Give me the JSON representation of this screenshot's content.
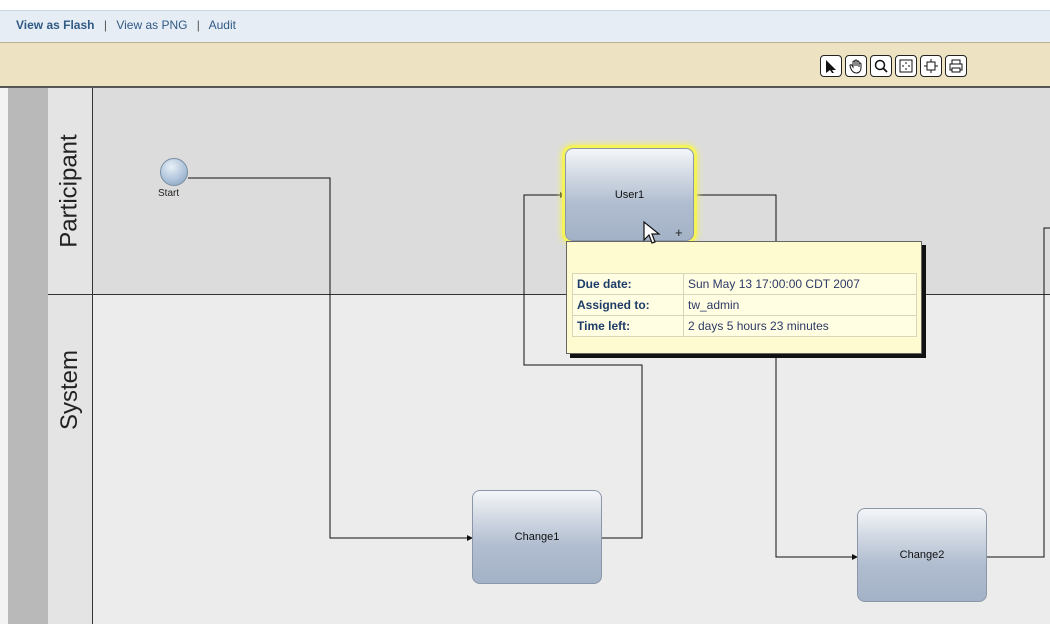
{
  "links": {
    "view_flash": "View as Flash",
    "separator": "|",
    "view_png": "View as PNG",
    "audit": "Audit"
  },
  "toolbar": {
    "buttons": [
      {
        "name": "select-tool",
        "icon": "arrow-pointer-icon"
      },
      {
        "name": "pan-tool",
        "icon": "hand-icon"
      },
      {
        "name": "zoom-tool",
        "icon": "magnifier-icon"
      },
      {
        "name": "fit-to-window",
        "icon": "fit-icon"
      },
      {
        "name": "center-view",
        "icon": "center-icon"
      },
      {
        "name": "print",
        "icon": "printer-icon"
      }
    ]
  },
  "lanes": {
    "participant": "Participant",
    "system": "System"
  },
  "nodes": {
    "start": "Start",
    "user1": "User1",
    "change1": "Change1",
    "change2": "Change2"
  },
  "tooltip": {
    "rows": [
      {
        "label": "Due date:",
        "value": "Sun May 13 17:00:00 CDT 2007"
      },
      {
        "label": "Assigned to:",
        "value": "tw_admin"
      },
      {
        "label": "Time left:",
        "value": "2 days 5 hours 23 minutes"
      }
    ]
  },
  "cursor_plus": "+",
  "colors": {
    "link": "#315a85",
    "toolbar_bg": "#ede3c2",
    "task_fill": "#b0bdd0",
    "highlight": "#f4f35a",
    "tooltip_bg": "#fffbd0"
  }
}
